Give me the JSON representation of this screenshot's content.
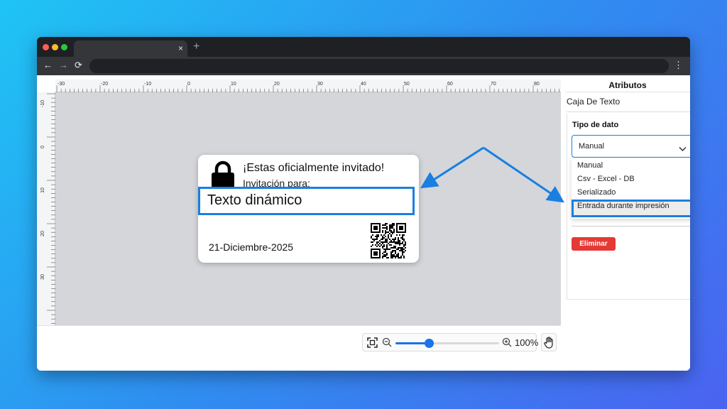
{
  "browser": {
    "tab_close": "×",
    "new_tab": "+",
    "back": "←",
    "forward": "→",
    "reload": "⟳",
    "menu": "⋮"
  },
  "rulers": {
    "top_labels": [
      "-30",
      "-20",
      "-10",
      "0",
      "10",
      "20",
      "30",
      "40",
      "50",
      "60",
      "70",
      "80"
    ],
    "left_labels": [
      "-10",
      "0",
      "10",
      "20",
      "30"
    ]
  },
  "label": {
    "icon": "lock-icon",
    "title": "¡Estas oficialmente invitado!",
    "subtitle": "Invitación para:",
    "dynamic_text": "Texto dinámico",
    "date": "21-Diciembre-2025",
    "qr_icon": "qr-code-icon"
  },
  "zoom": {
    "value": "100%",
    "level": 0.32
  },
  "panel": {
    "header": "Atributos",
    "section": "Caja De Texto",
    "data_type_label": "Tipo de dato",
    "selected": "Manual",
    "options": [
      "Manual",
      "Csv - Excel - DB",
      "Serializado",
      "Entrada durante impresión"
    ],
    "highlighted_option": "Entrada durante impresión",
    "delete_label": "Eliminar"
  },
  "colors": {
    "accent": "#1a7fe0",
    "danger": "#e53935",
    "canvas_bg": "#d4d6da"
  }
}
